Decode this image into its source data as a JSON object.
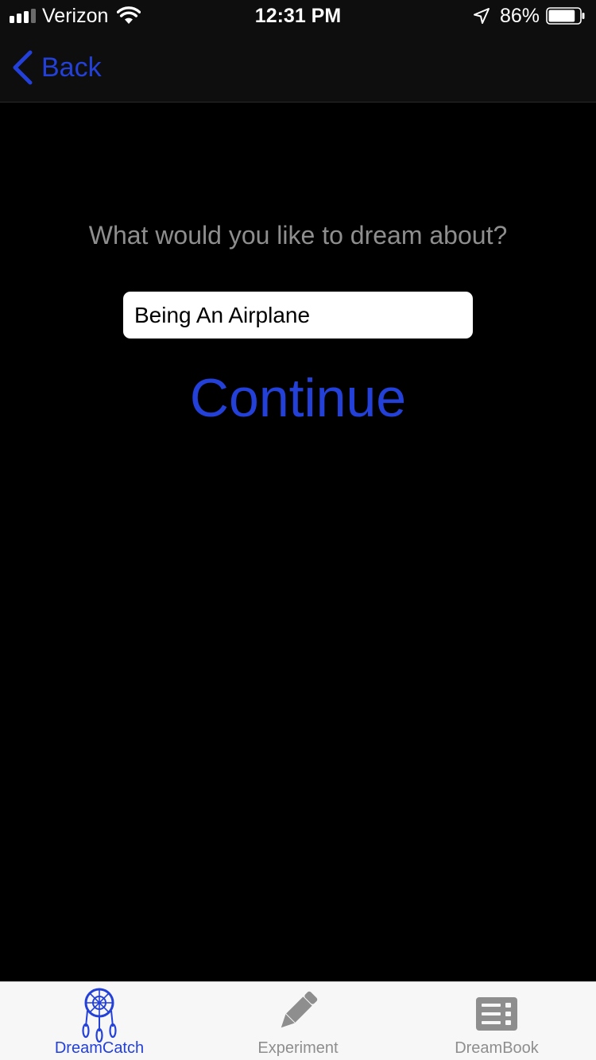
{
  "status_bar": {
    "carrier": "Verizon",
    "time": "12:31 PM",
    "battery_percent": "86%",
    "battery_level": 0.86,
    "icons": [
      "signal-icon",
      "wifi-icon",
      "location-arrow-icon",
      "battery-icon"
    ]
  },
  "nav": {
    "back_label": "Back"
  },
  "main": {
    "prompt": "What would you like to dream about?",
    "dream_input_value": "Being An Airplane",
    "continue_label": "Continue"
  },
  "tabs": [
    {
      "label": "DreamCatch",
      "icon": "dreamcatcher-icon",
      "active": true
    },
    {
      "label": "Experiment",
      "icon": "pen-icon",
      "active": false
    },
    {
      "label": "DreamBook",
      "icon": "list-book-icon",
      "active": false
    }
  ],
  "colors": {
    "accent": "#2340d8",
    "background": "#000000",
    "bar_background": "#0e0e0e",
    "prompt_text": "#8e8e8e",
    "tab_bar_background": "#f7f7f7",
    "tab_inactive": "#8e8e8e"
  }
}
